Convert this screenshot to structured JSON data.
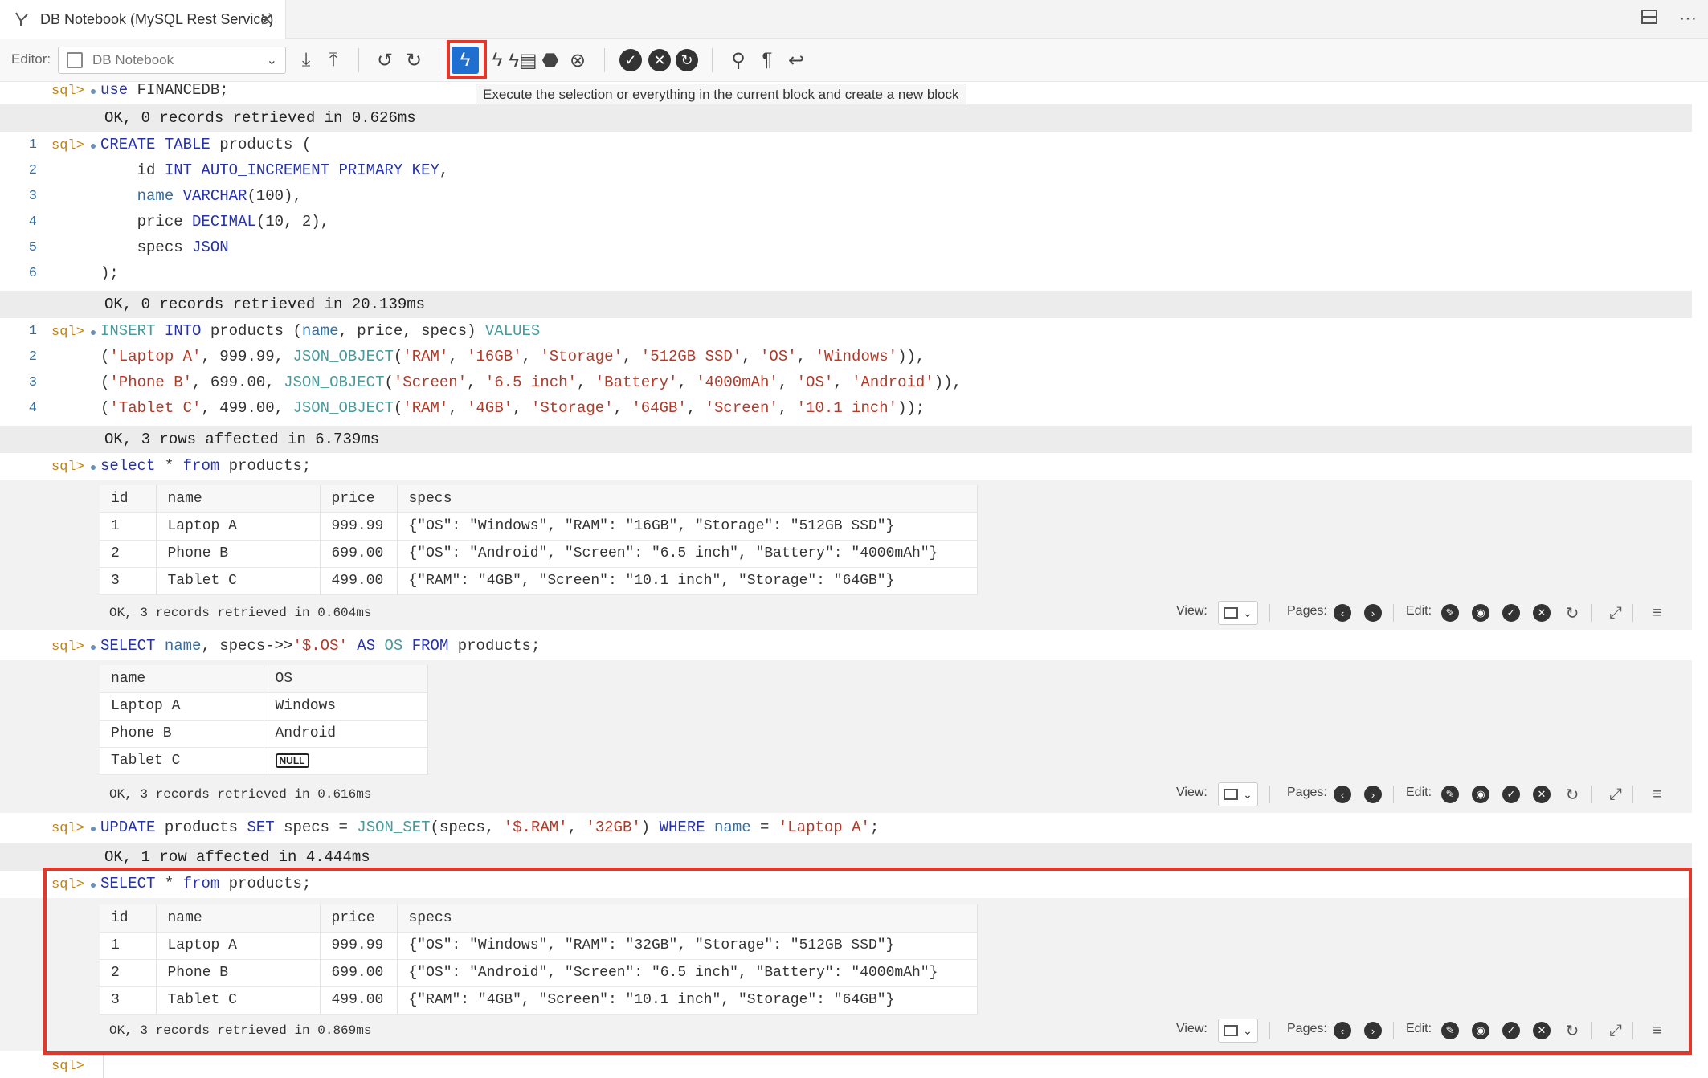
{
  "tab": {
    "title": "DB Notebook (MySQL Rest Service)",
    "close": "✕"
  },
  "toolbar": {
    "editor_label": "Editor:",
    "editor_value": "DB Notebook",
    "tooltip": "Execute the selection or everything in the current block and create a new block"
  },
  "prompt": "sql>",
  "blocks": {
    "use": {
      "code": "use FINANCEDB;",
      "result": "OK, 0 records retrieved in 0.626ms"
    },
    "create": {
      "lines": [
        "1",
        "2",
        "3",
        "4",
        "5",
        "6"
      ],
      "result": "OK, 0 records retrieved in 20.139ms"
    },
    "insert": {
      "lines": [
        "1",
        "2",
        "3",
        "4"
      ],
      "result": "OK, 3 rows affected in 6.739ms"
    },
    "select1": {
      "headers": [
        "id",
        "name",
        "price",
        "specs"
      ],
      "rows": [
        [
          "1",
          "Laptop A",
          "999.99",
          "{\"OS\": \"Windows\", \"RAM\": \"16GB\", \"Storage\": \"512GB SSD\"}"
        ],
        [
          "2",
          "Phone B",
          "699.00",
          "{\"OS\": \"Android\", \"Screen\": \"6.5 inch\", \"Battery\": \"4000mAh\"}"
        ],
        [
          "3",
          "Tablet C",
          "499.00",
          "{\"RAM\": \"4GB\", \"Screen\": \"10.1 inch\", \"Storage\": \"64GB\"}"
        ]
      ],
      "status": "OK, 3 records retrieved in 0.604ms"
    },
    "select2": {
      "headers": [
        "name",
        "OS"
      ],
      "rows": [
        [
          "Laptop A",
          "Windows"
        ],
        [
          "Phone B",
          "Android"
        ],
        [
          "Tablet C",
          "NULL"
        ]
      ],
      "status": "OK, 3 records retrieved in 0.616ms"
    },
    "update": {
      "result": "OK, 1 row affected in 4.444ms"
    },
    "select3": {
      "headers": [
        "id",
        "name",
        "price",
        "specs"
      ],
      "rows": [
        [
          "1",
          "Laptop A",
          "999.99",
          "{\"OS\": \"Windows\", \"RAM\": \"32GB\", \"Storage\": \"512GB SSD\"}"
        ],
        [
          "2",
          "Phone B",
          "699.00",
          "{\"OS\": \"Android\", \"Screen\": \"6.5 inch\", \"Battery\": \"4000mAh\"}"
        ],
        [
          "3",
          "Tablet C",
          "499.00",
          "{\"RAM\": \"4GB\", \"Screen\": \"10.1 inch\", \"Storage\": \"64GB\"}"
        ]
      ],
      "status": "OK, 3 records retrieved in 0.869ms"
    }
  },
  "status_bar": {
    "view": "View:",
    "pages": "Pages:",
    "edit": "Edit:"
  },
  "colors": {
    "accent": "#1f6fd1",
    "highlight": "#e0392b",
    "keyword": "#2632a8",
    "string": "#b13b2a"
  }
}
